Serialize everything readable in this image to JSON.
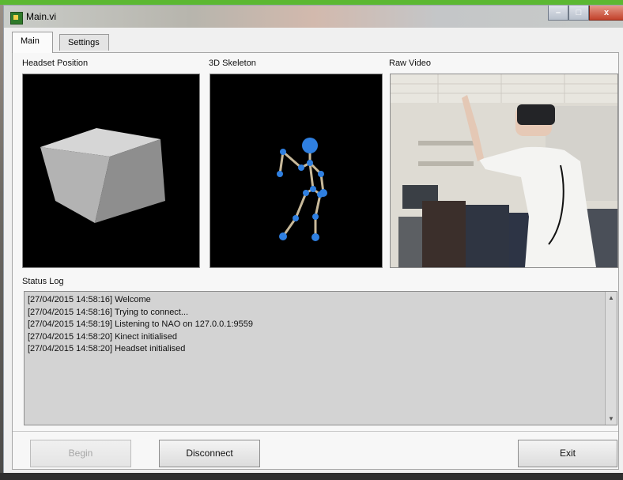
{
  "window": {
    "title": "Main.vi",
    "controls": {
      "minimize": "–",
      "maximize": "□",
      "close": "x"
    }
  },
  "tabs": [
    {
      "label": "Main"
    },
    {
      "label": "Settings"
    }
  ],
  "panels": {
    "headset": "Headset Position",
    "skeleton": "3D Skeleton",
    "video": "Raw Video"
  },
  "status": {
    "title": "Status Log",
    "lines": [
      "[27/04/2015 14:58:16] Welcome",
      "[27/04/2015 14:58:16] Trying to connect...",
      "[27/04/2015 14:58:19] Listening to NAO on 127.0.0.1:9559",
      "[27/04/2015 14:58:20] Kinect initialised",
      "[27/04/2015 14:58:20] Headset initialised"
    ]
  },
  "buttons": {
    "begin": "Begin",
    "disconnect": "Disconnect",
    "exit": "Exit"
  },
  "colors": {
    "skeleton_joint": "#2f7fe0",
    "skeleton_bone": "#c8b99a",
    "titlebar_accent": "#5cb832"
  }
}
